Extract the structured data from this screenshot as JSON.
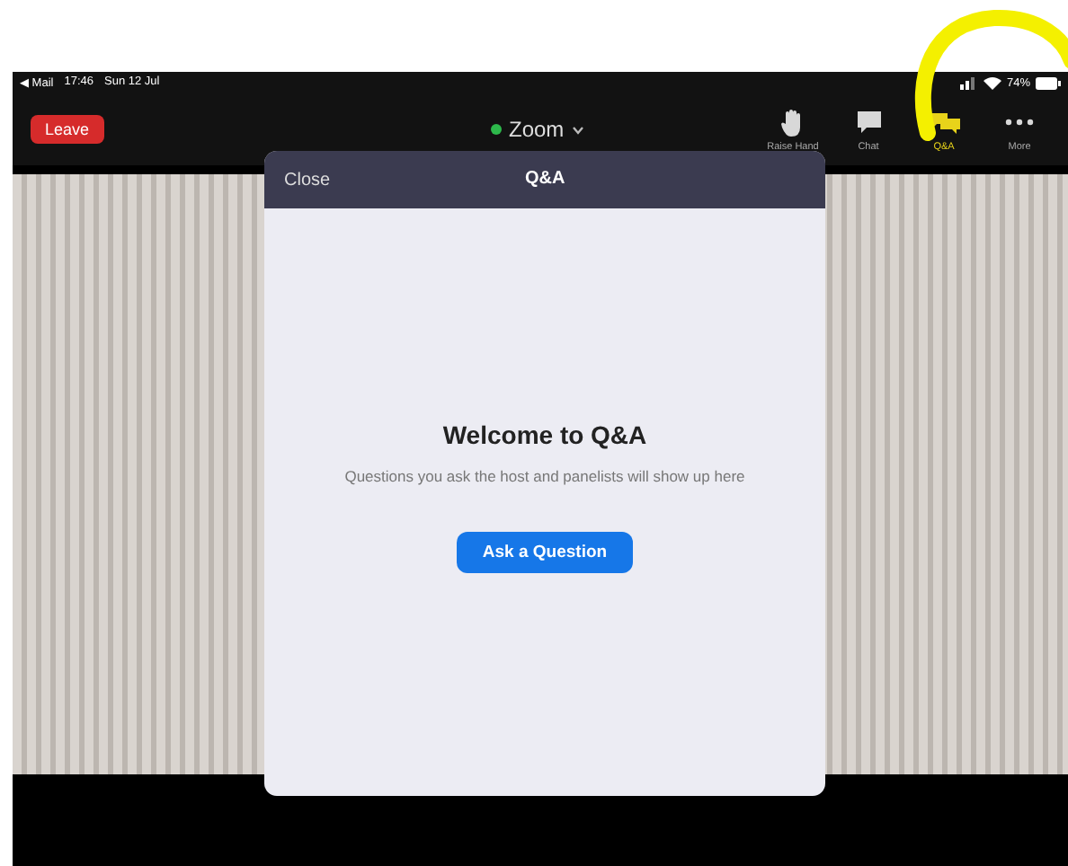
{
  "status_bar": {
    "back_app": "◀ Mail",
    "time": "17:46",
    "date": "Sun 12 Jul",
    "battery": "74%"
  },
  "toolbar": {
    "leave": "Leave",
    "meeting": "Zoom",
    "connected": true,
    "items": [
      {
        "kind": "hand",
        "label": "Raise Hand",
        "selected": false
      },
      {
        "kind": "chat",
        "label": "Chat",
        "selected": false
      },
      {
        "kind": "qa",
        "label": "Q&A",
        "selected": true
      },
      {
        "kind": "more",
        "label": "More",
        "selected": false
      }
    ]
  },
  "dialog": {
    "close": "Close",
    "title": "Q&A",
    "heading": "Welcome to Q&A",
    "message": "Questions you ask the host and panelists will show up here",
    "button": "Ask a Question"
  }
}
